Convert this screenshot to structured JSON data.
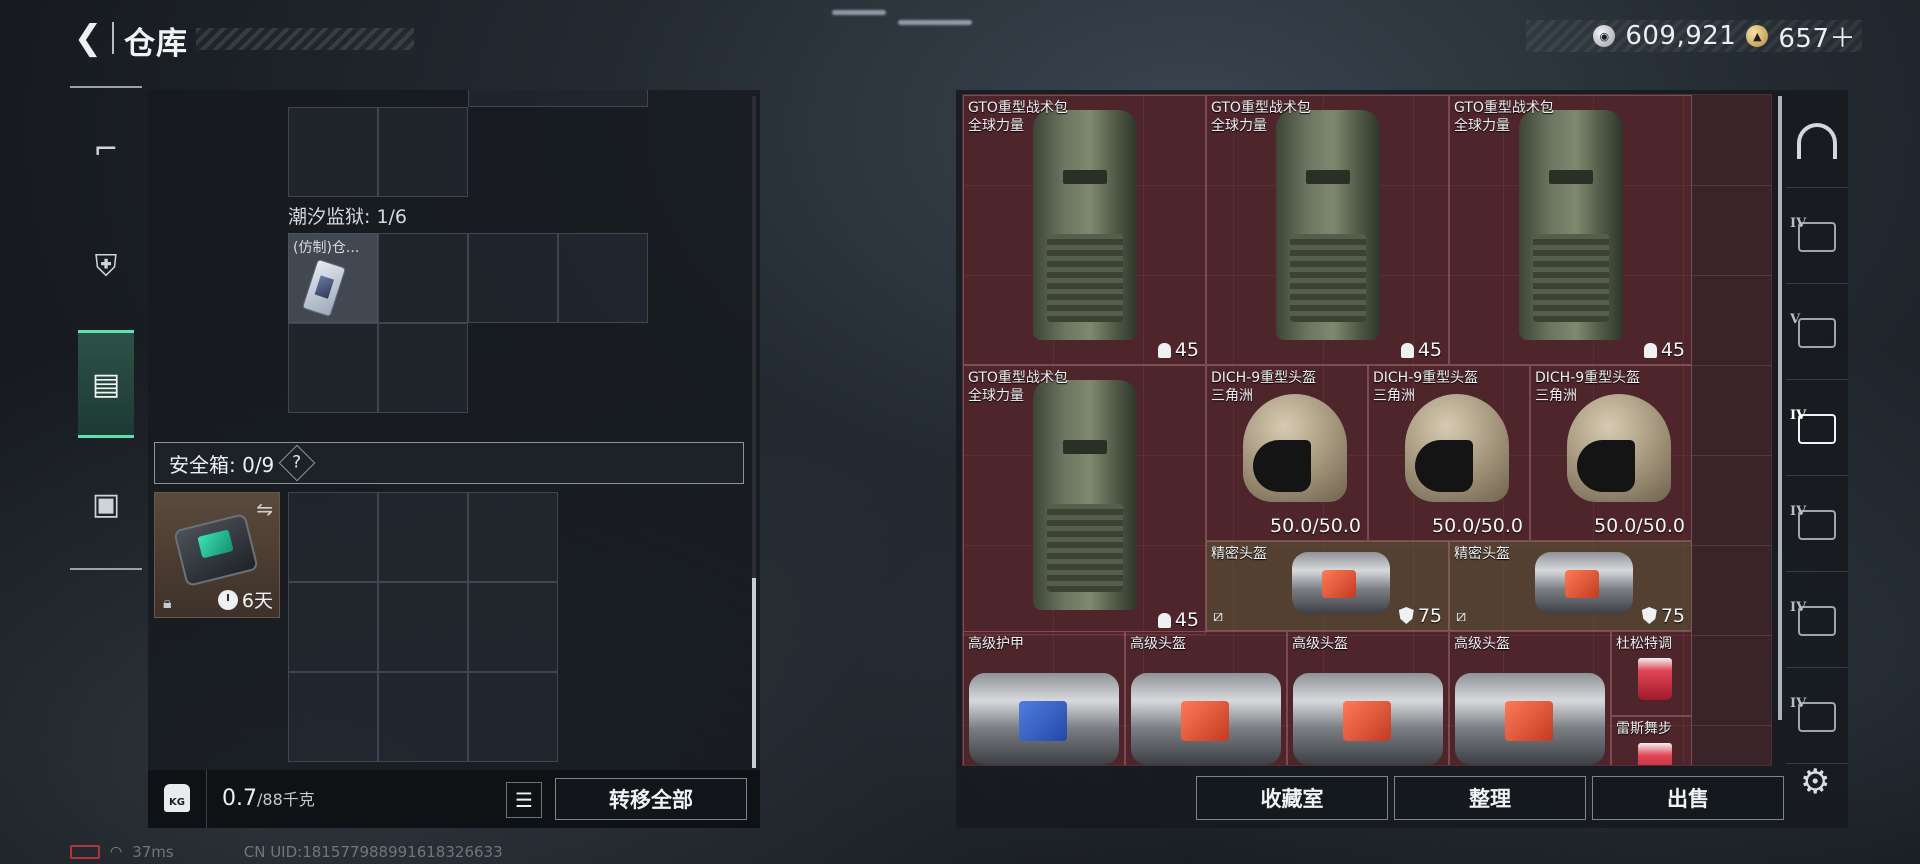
{
  "header": {
    "back_icon": "chevron-left-icon",
    "title": "仓库",
    "currencies": [
      {
        "icon": "silver-coin-icon",
        "value": "609,921"
      },
      {
        "icon": "gold-coin-icon",
        "value": "657＋"
      }
    ]
  },
  "left_tabs": [
    {
      "icon": "pistol-icon",
      "active": false
    },
    {
      "icon": "armor-vest-icon",
      "active": false
    },
    {
      "icon": "backpack-icon",
      "active": true
    },
    {
      "icon": "briefcase-icon",
      "active": false
    }
  ],
  "container": {
    "label": "潮汐监狱: 1/6",
    "item_name": "(仿制)仓..."
  },
  "safe_box": {
    "label": "安全箱: 0/9",
    "help": "?",
    "timer": "6天",
    "swap_icon": "swap-icon",
    "lock_icon": "lock-icon"
  },
  "footer_left": {
    "weight_current": "0.7",
    "weight_max": "/88千克",
    "kg_icon_text": "KG",
    "transfer_all": "转移全部"
  },
  "status": {
    "ping": "37ms",
    "uid": "CN UID:181577988991618326633"
  },
  "stash_items": [
    {
      "name": "GTO重型战术包",
      "sub": "全球力量",
      "value": "45",
      "kind": "backpack",
      "rarity": "red"
    },
    {
      "name": "GTO重型战术包",
      "sub": "全球力量",
      "value": "45",
      "kind": "backpack",
      "rarity": "red"
    },
    {
      "name": "GTO重型战术包",
      "sub": "全球力量",
      "value": "45",
      "kind": "backpack",
      "rarity": "red"
    },
    {
      "name": "GTO重型战术包",
      "sub": "全球力量",
      "value": "45",
      "kind": "backpack",
      "rarity": "red"
    },
    {
      "name": "DICH-9重型头盔",
      "sub": "三角洲",
      "value": "50.0/50.0",
      "kind": "helmet",
      "rarity": "red"
    },
    {
      "name": "DICH-9重型头盔",
      "sub": "三角洲",
      "value": "50.0/50.0",
      "kind": "helmet",
      "rarity": "red"
    },
    {
      "name": "DICH-9重型头盔",
      "sub": "三角洲",
      "value": "50.0/50.0",
      "kind": "helmet",
      "rarity": "red"
    },
    {
      "name": "精密头盔",
      "sub": "",
      "value": "75",
      "kind": "bag",
      "rarity": "gold"
    },
    {
      "name": "精密头盔",
      "sub": "",
      "value": "75",
      "kind": "bag",
      "rarity": "gold"
    },
    {
      "name": "高级护甲",
      "sub": "",
      "value": "",
      "kind": "bag-blue",
      "rarity": "red"
    },
    {
      "name": "高级头盔",
      "sub": "",
      "value": "",
      "kind": "bag",
      "rarity": "red"
    },
    {
      "name": "高级头盔",
      "sub": "",
      "value": "",
      "kind": "bag",
      "rarity": "red"
    },
    {
      "name": "高级头盔",
      "sub": "",
      "value": "",
      "kind": "bag",
      "rarity": "red"
    },
    {
      "name": "杜松特调",
      "sub": "",
      "value": "",
      "kind": "drink",
      "rarity": "red"
    },
    {
      "name": "雷斯舞步",
      "sub": "",
      "value": "",
      "kind": "drink",
      "rarity": "red"
    }
  ],
  "right_categories": [
    {
      "icon": "home-icon",
      "num": ""
    },
    {
      "icon": "category-iv-icon",
      "num": "IV"
    },
    {
      "icon": "category-v-icon",
      "num": "V"
    },
    {
      "icon": "category-iv-active-icon",
      "num": "IV"
    },
    {
      "icon": "category-iv-icon",
      "num": "IV"
    },
    {
      "icon": "category-iv-icon",
      "num": "IV"
    },
    {
      "icon": "category-iv-icon",
      "num": "IV"
    }
  ],
  "actions": {
    "collection": "收藏室",
    "organize": "整理",
    "sell": "出售"
  }
}
